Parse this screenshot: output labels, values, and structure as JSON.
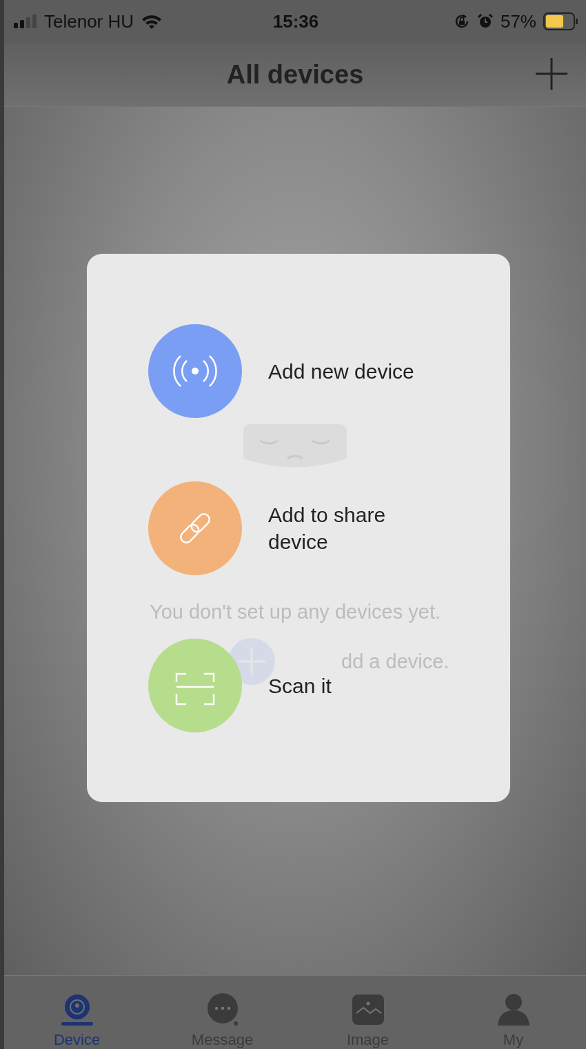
{
  "status_bar": {
    "carrier": "Telenor HU",
    "time": "15:36",
    "battery": "57%"
  },
  "header": {
    "title": "All devices"
  },
  "empty_state": {
    "message": "You don't set up any devices yet.",
    "hint": "dd a device."
  },
  "menu": {
    "items": [
      {
        "kind": "add",
        "label": "Add new device",
        "color": "#7b9ef5"
      },
      {
        "kind": "share",
        "label": "Add to share device",
        "color": "#f2b27a"
      },
      {
        "kind": "scan",
        "label": "Scan it",
        "color": "#b5dd8c"
      }
    ]
  },
  "tabs": [
    {
      "label": "Device",
      "kind": "device",
      "selected": true
    },
    {
      "label": "Message",
      "kind": "message",
      "selected": false
    },
    {
      "label": "Image",
      "kind": "image",
      "selected": false
    },
    {
      "label": "My",
      "kind": "my",
      "selected": false
    }
  ]
}
